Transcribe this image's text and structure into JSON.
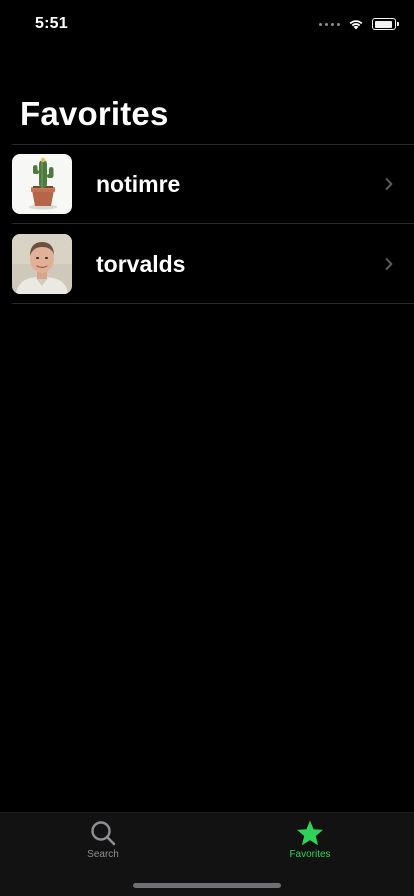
{
  "status_bar": {
    "time": "5:51",
    "icons": [
      "cellular-signal-icon",
      "wifi-icon",
      "battery-icon"
    ]
  },
  "nav": {
    "title": "Favorites"
  },
  "favorites": [
    {
      "name": "notimre",
      "avatar_icon": "cactus-avatar",
      "accessory_icon": "chevron-right-icon"
    },
    {
      "name": "torvalds",
      "avatar_icon": "person-portrait-avatar",
      "accessory_icon": "chevron-right-icon"
    }
  ],
  "tab_bar": {
    "tabs": [
      {
        "label": "Search",
        "icon": "magnifying-glass-icon",
        "selected": false
      },
      {
        "label": "Favorites",
        "icon": "star-icon",
        "selected": true
      }
    ]
  },
  "colors": {
    "background": "#000000",
    "tab_bar_background": "#121212",
    "accent": "#30d158",
    "inactive_tab": "#8e8e93",
    "separator": "#2a2a2c",
    "chevron": "#5a5a5e"
  }
}
